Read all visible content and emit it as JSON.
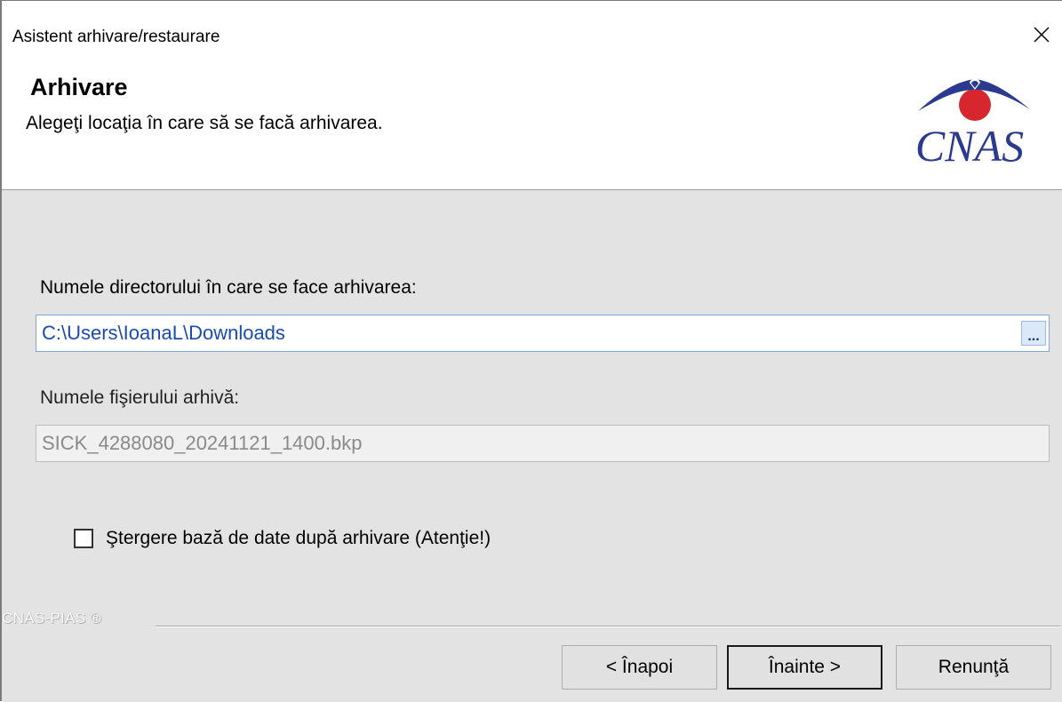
{
  "window": {
    "title": "Asistent arhivare/restaurare"
  },
  "header": {
    "heading": "Arhivare",
    "subheading": "Alegeţi locaţia în care să se facă arhivarea.",
    "logo_text": "CNAS",
    "logo_icon": "cnas-logo"
  },
  "form": {
    "directory_label": "Numele directorului în care se face arhivarea:",
    "directory_value": "C:\\Users\\IoanaL\\Downloads",
    "browse_label": "...",
    "file_label": "Numele fişierului arhivă:",
    "file_value": "SICK_4288080_20241121_1400.bkp",
    "delete_checkbox_label": "Ştergere bază de date după arhivare (Atenţie!)",
    "delete_checked": false
  },
  "footer": {
    "brand": "CNAS-PIAS ®",
    "back_label": "< Înapoi",
    "next_label": "Înainte >",
    "cancel_label": "Renunţă"
  },
  "colors": {
    "accent_blue": "#2b3a8f",
    "logo_red": "#d7262e",
    "content_bg": "#e3e3e3",
    "input_text_blue": "#1a4bb0"
  }
}
